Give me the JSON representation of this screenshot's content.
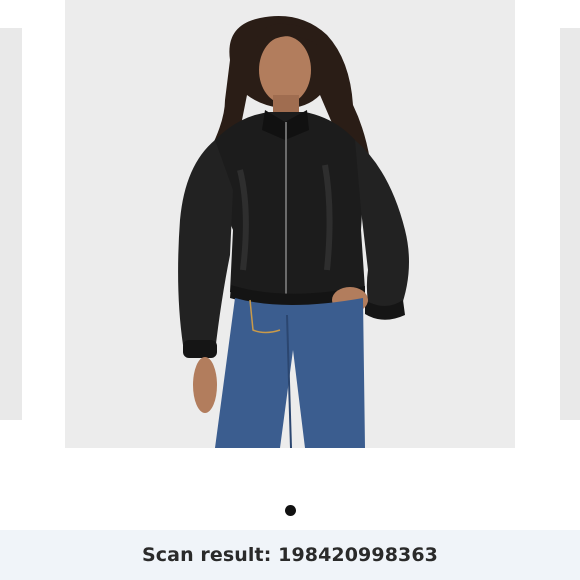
{
  "carousel": {
    "image_alt": "Woman wearing black faux leather bomber jacket and blue jeans",
    "dots": [
      {
        "active": true
      }
    ]
  },
  "scan": {
    "label": "Scan result:",
    "value": "198420998363"
  },
  "colors": {
    "result_bar_bg": "#f0f4f9",
    "active_dot": "#111111"
  }
}
